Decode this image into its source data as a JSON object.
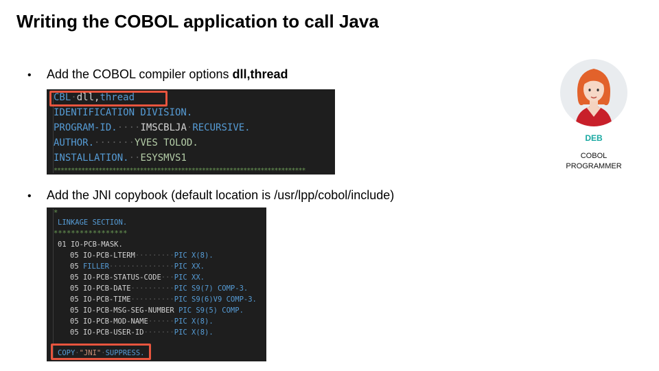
{
  "slide": {
    "title": "Writing the COBOL application to call Java",
    "bullet1": {
      "marker": "•",
      "text_before": "Add the COBOL compiler options ",
      "text_bold": "dll,thread"
    },
    "bullet2": {
      "marker": "•",
      "text": "Add the JNI copybook (default location is /usr/lpp/cobol/include)"
    }
  },
  "code1": {
    "cbl": "CBL",
    "dll": "dll,",
    "thread": "thread",
    "identification": "IDENTIFICATION DIVISION.",
    "program_id_label": "PROGRAM-ID.",
    "program_id_value": "IMSCBLJA",
    "program_id_recursive": "RECURSIVE.",
    "author_label": "AUTHOR.",
    "author_value": "YVES TOLOD.",
    "installation_label": "INSTALLATION.",
    "installation_value": "ESYSMVS1"
  },
  "code2": {
    "comment_star": "*",
    "linkage": "LINKAGE SECTION.",
    "stars": "*****************",
    "mask": "01 IO-PCB-MASK.",
    "rows": [
      {
        "level": "05",
        "name": "IO-PCB-LTERM",
        "pic": "PIC X(8)."
      },
      {
        "level": "05",
        "name": "FILLER",
        "pic": "PIC XX."
      },
      {
        "level": "05",
        "name": "IO-PCB-STATUS-CODE",
        "pic": "PIC XX."
      },
      {
        "level": "05",
        "name": "IO-PCB-DATE",
        "pic": "PIC S9(7) COMP-3."
      },
      {
        "level": "05",
        "name": "IO-PCB-TIME",
        "pic": "PIC S9(6)V9 COMP-3."
      },
      {
        "level": "05",
        "name": "IO-PCB-MSG-SEG-NUMBER",
        "pic": "PIC S9(5) COMP."
      },
      {
        "level": "05",
        "name": "IO-PCB-MOD-NAME",
        "pic": "PIC X(8)."
      },
      {
        "level": "05",
        "name": "IO-PCB-USER-ID",
        "pic": "PIC X(8)."
      }
    ],
    "copy_kw": "COPY",
    "copy_name": "\"JNI\"",
    "copy_suppress": "SUPPRESS."
  },
  "persona": {
    "name": "DEB",
    "role_line1": "COBOL",
    "role_line2": "PROGRAMMER"
  },
  "colors": {
    "highlight": "#e8553e",
    "persona_name": "#19a9a2",
    "code_bg": "#1e1e1e"
  }
}
